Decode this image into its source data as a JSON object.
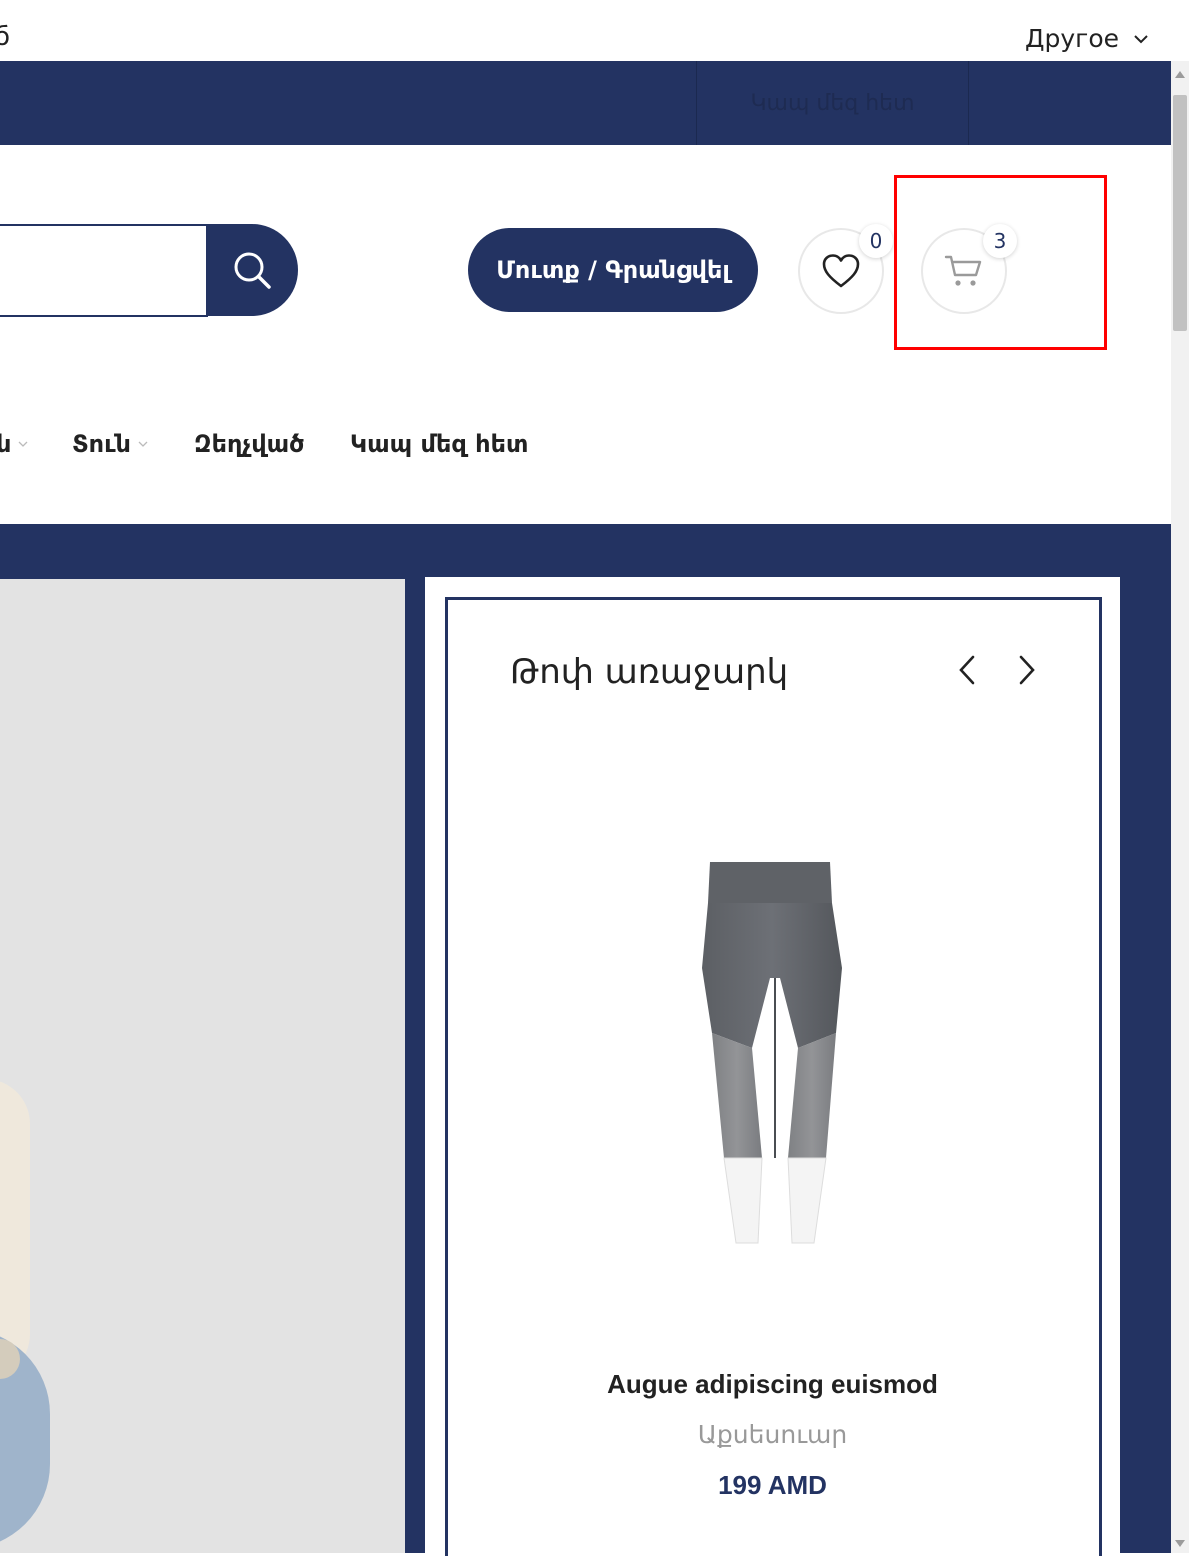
{
  "topbar": {
    "cut_text": "б",
    "language": "Другое"
  },
  "navstrip": {
    "contact_label": "Կապ մեզ հետ"
  },
  "header": {
    "search_placeholder": "",
    "login_label": "Մուտք / Գրանցվել",
    "wishlist_count": "0",
    "cart_count": "3"
  },
  "menu": {
    "items": [
      {
        "label": "ն"
      },
      {
        "label": "Տուն"
      },
      {
        "label": "Զեղչված"
      },
      {
        "label": "Կապ մեզ հետ"
      }
    ]
  },
  "offer": {
    "title": "Թոփ առաջարկ",
    "product": {
      "name": "Augue adipiscing euismod",
      "category": "Աքսեսուար",
      "price": "199 AMD"
    }
  },
  "colors": {
    "primary": "#233362",
    "highlight": "#ff0000"
  },
  "icons": [
    "chevron-down-icon",
    "search-icon",
    "heart-icon",
    "cart-icon",
    "chevron-left-icon",
    "chevron-right-icon"
  ]
}
